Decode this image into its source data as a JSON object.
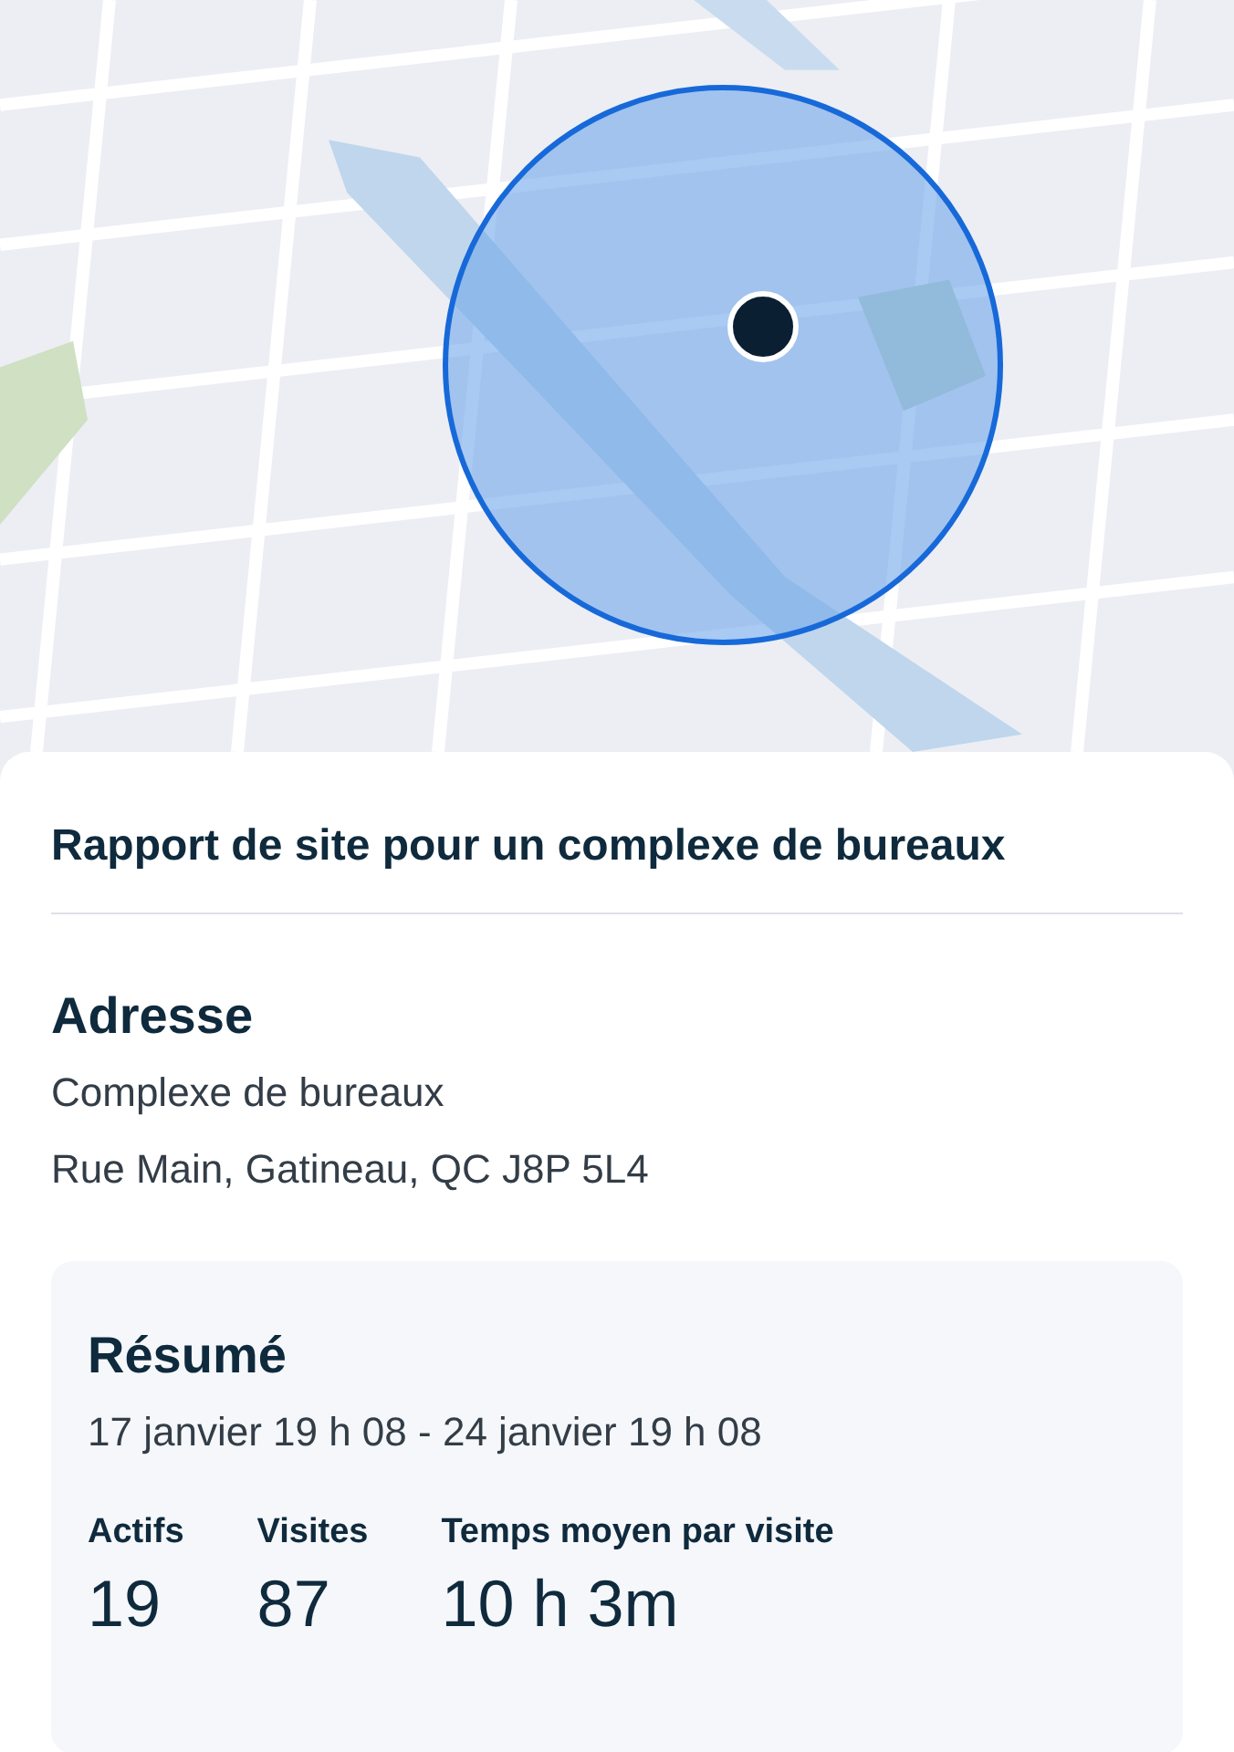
{
  "report": {
    "title": "Rapport de site pour un complexe de bureaux"
  },
  "address": {
    "heading": "Adresse",
    "lines": [
      "Complexe de bureaux",
      "Rue Main, Gatineau, QC J8P 5L4"
    ]
  },
  "summary": {
    "heading": "Résumé",
    "period": "17 janvier 19 h 08 - 24 janvier 19 h 08",
    "stats": [
      {
        "label": "Actifs",
        "value": "19"
      },
      {
        "label": "Visites",
        "value": "87"
      },
      {
        "label": "Temps moyen par visite",
        "value": "10 h 3m"
      }
    ]
  }
}
